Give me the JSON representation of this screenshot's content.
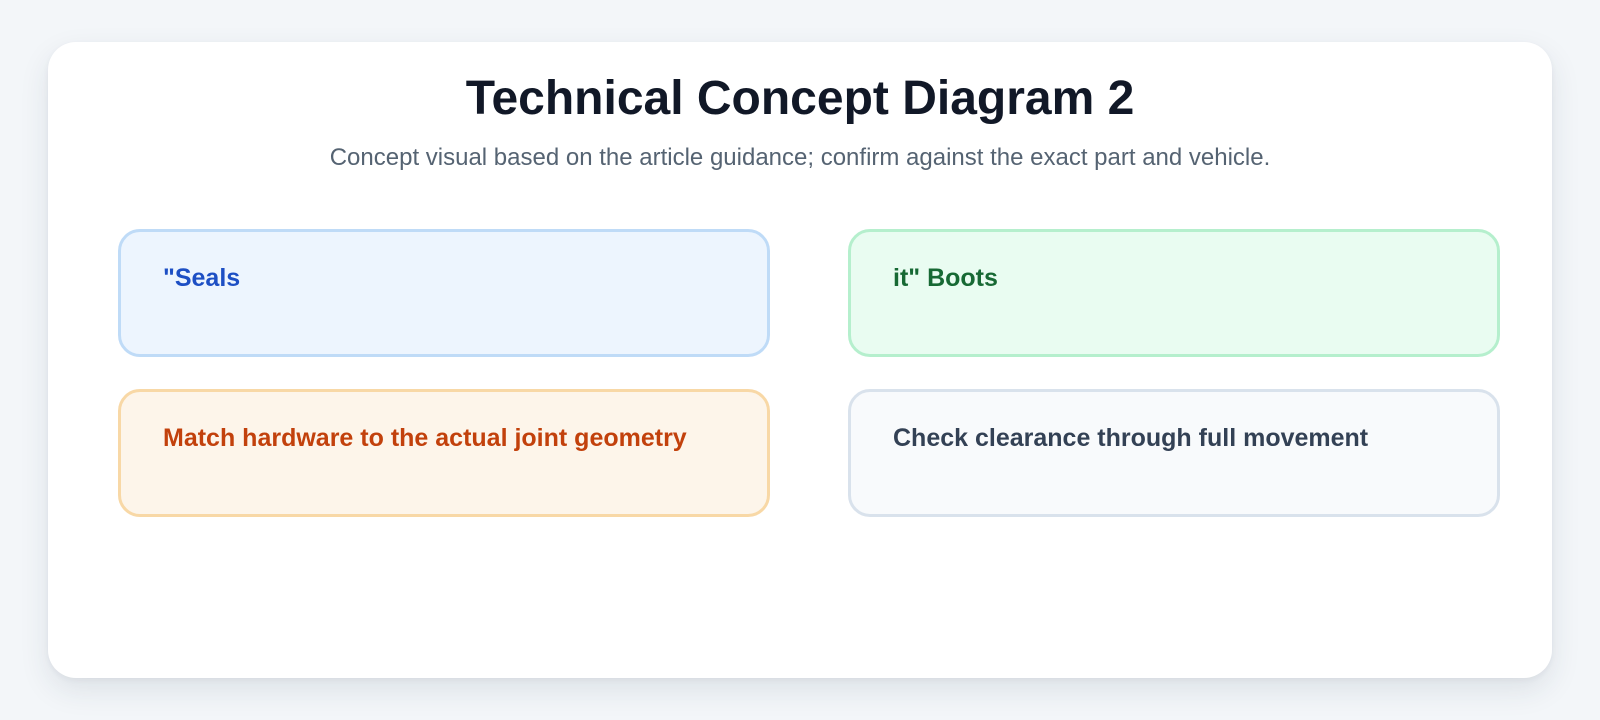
{
  "diagram": {
    "title": "Technical Concept Diagram 2",
    "subtitle": "Concept visual based on the article guidance; confirm against the exact part and vehicle.",
    "boxes": [
      {
        "label": "\"Seals",
        "text_color": "#1d4fc4",
        "background": "#edf5fe",
        "border_color": "#bfdbf7"
      },
      {
        "label": "it\" Boots",
        "text_color": "#176934",
        "background": "#e9fcf1",
        "border_color": "#b5efcd"
      },
      {
        "label": "Match hardware to the actual joint geometry",
        "text_color": "#c2410c",
        "background": "#fdf5ea",
        "border_color": "#f8d8a6"
      },
      {
        "label": "Check clearance through full movement",
        "text_color": "#334155",
        "background": "#f8fafc",
        "border_color": "#d9e2ec"
      }
    ]
  }
}
